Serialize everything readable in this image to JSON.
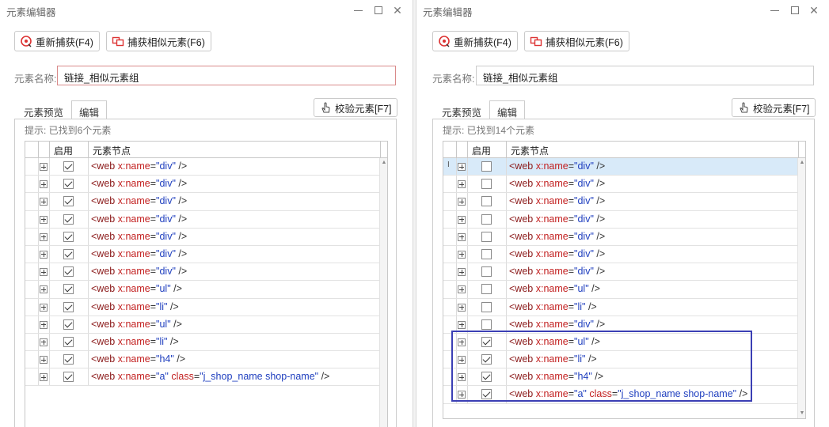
{
  "left": {
    "title": "元素编辑器",
    "buttons": {
      "recapture": "重新捕获(F4)",
      "capture_similar": "捕获相似元素(F6)",
      "verify": "校验元素[F7]"
    },
    "name_label": "元素名称:",
    "name_value": "链接_相似元素组",
    "tabs": [
      "元素预览",
      "编辑"
    ],
    "hint": "提示: 已找到6个元素",
    "columns": {
      "enable": "启用",
      "node": "元素节点"
    },
    "rows": [
      {
        "enabled": true,
        "tag": "<web ",
        "attrs": [
          {
            "k": "x:name",
            "v": "\"div\""
          }
        ]
      },
      {
        "enabled": true,
        "tag": "<web ",
        "attrs": [
          {
            "k": "x:name",
            "v": "\"div\""
          }
        ]
      },
      {
        "enabled": true,
        "tag": "<web ",
        "attrs": [
          {
            "k": "x:name",
            "v": "\"div\""
          }
        ]
      },
      {
        "enabled": true,
        "tag": "<web ",
        "attrs": [
          {
            "k": "x:name",
            "v": "\"div\""
          }
        ]
      },
      {
        "enabled": true,
        "tag": "<web ",
        "attrs": [
          {
            "k": "x:name",
            "v": "\"div\""
          }
        ]
      },
      {
        "enabled": true,
        "tag": "<web ",
        "attrs": [
          {
            "k": "x:name",
            "v": "\"div\""
          }
        ]
      },
      {
        "enabled": true,
        "tag": "<web ",
        "attrs": [
          {
            "k": "x:name",
            "v": "\"div\""
          }
        ]
      },
      {
        "enabled": true,
        "tag": "<web ",
        "attrs": [
          {
            "k": "x:name",
            "v": "\"ul\""
          }
        ]
      },
      {
        "enabled": true,
        "tag": "<web ",
        "attrs": [
          {
            "k": "x:name",
            "v": "\"li\""
          }
        ]
      },
      {
        "enabled": true,
        "tag": "<web ",
        "attrs": [
          {
            "k": "x:name",
            "v": "\"ul\""
          }
        ]
      },
      {
        "enabled": true,
        "tag": "<web ",
        "attrs": [
          {
            "k": "x:name",
            "v": "\"li\""
          }
        ]
      },
      {
        "enabled": true,
        "tag": "<web ",
        "attrs": [
          {
            "k": "x:name",
            "v": "\"h4\""
          }
        ]
      },
      {
        "enabled": true,
        "tag": "<web ",
        "attrs": [
          {
            "k": "x:name",
            "v": "\"a\""
          },
          {
            "k": "class",
            "v": "\"j_shop_name shop-name\""
          }
        ]
      }
    ]
  },
  "right": {
    "title": "元素编辑器",
    "buttons": {
      "recapture": "重新捕获(F4)",
      "capture_similar": "捕获相似元素(F6)",
      "verify": "校验元素[F7]"
    },
    "name_label": "元素名称:",
    "name_value": "链接_相似元素组",
    "tabs": [
      "元素预览",
      "编辑"
    ],
    "hint": "提示: 已找到14个元素",
    "columns": {
      "enable": "启用",
      "node": "元素节点"
    },
    "row_indicator": "I",
    "rows": [
      {
        "enabled": false,
        "tag": "<web ",
        "attrs": [
          {
            "k": "x:name",
            "v": "\"div\""
          }
        ]
      },
      {
        "enabled": false,
        "tag": "<web ",
        "attrs": [
          {
            "k": "x:name",
            "v": "\"div\""
          }
        ]
      },
      {
        "enabled": false,
        "tag": "<web ",
        "attrs": [
          {
            "k": "x:name",
            "v": "\"div\""
          }
        ]
      },
      {
        "enabled": false,
        "tag": "<web ",
        "attrs": [
          {
            "k": "x:name",
            "v": "\"div\""
          }
        ]
      },
      {
        "enabled": false,
        "tag": "<web ",
        "attrs": [
          {
            "k": "x:name",
            "v": "\"div\""
          }
        ]
      },
      {
        "enabled": false,
        "tag": "<web ",
        "attrs": [
          {
            "k": "x:name",
            "v": "\"div\""
          }
        ]
      },
      {
        "enabled": false,
        "tag": "<web ",
        "attrs": [
          {
            "k": "x:name",
            "v": "\"div\""
          }
        ]
      },
      {
        "enabled": false,
        "tag": "<web ",
        "attrs": [
          {
            "k": "x:name",
            "v": "\"ul\""
          }
        ]
      },
      {
        "enabled": false,
        "tag": "<web ",
        "attrs": [
          {
            "k": "x:name",
            "v": "\"li\""
          }
        ]
      },
      {
        "enabled": false,
        "tag": "<web ",
        "attrs": [
          {
            "k": "x:name",
            "v": "\"div\""
          }
        ]
      },
      {
        "enabled": true,
        "tag": "<web ",
        "attrs": [
          {
            "k": "x:name",
            "v": "\"ul\""
          }
        ]
      },
      {
        "enabled": true,
        "tag": "<web ",
        "attrs": [
          {
            "k": "x:name",
            "v": "\"li\""
          }
        ]
      },
      {
        "enabled": true,
        "tag": "<web ",
        "attrs": [
          {
            "k": "x:name",
            "v": "\"h4\""
          }
        ]
      },
      {
        "enabled": true,
        "tag": "<web ",
        "attrs": [
          {
            "k": "x:name",
            "v": "\"a\""
          },
          {
            "k": "class",
            "v": "\"j_shop_name shop-name\""
          }
        ]
      }
    ]
  },
  "colors": {
    "highlight_border": "#3b3fb4",
    "selected_row": "#d8eaf9",
    "tag_text": "#8b1a1a",
    "attr_value": "#1f3fbf"
  },
  "icons": [
    "recapture-icon",
    "capture-similar-icon",
    "pointer-hand-icon",
    "minimize-icon",
    "maximize-icon",
    "close-icon",
    "expand-plus-icon"
  ]
}
